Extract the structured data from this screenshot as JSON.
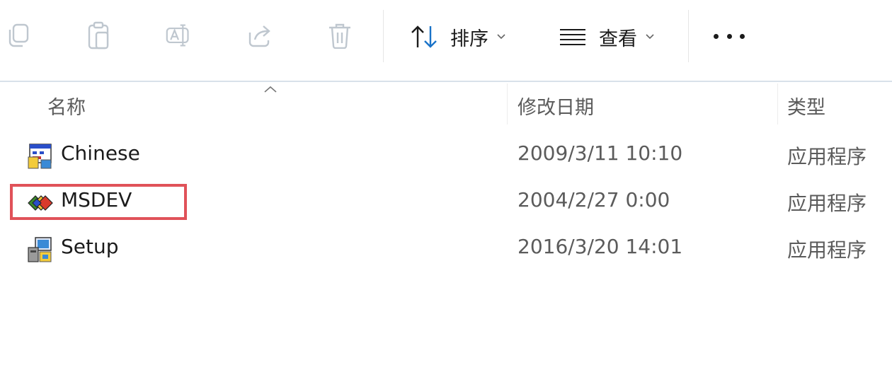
{
  "toolbar": {
    "icons": [
      {
        "name": "copy-icon"
      },
      {
        "name": "paste-icon"
      },
      {
        "name": "rename-icon"
      },
      {
        "name": "share-icon"
      },
      {
        "name": "delete-icon"
      }
    ],
    "sort_label": "排序",
    "view_label": "查看",
    "more_icon": "more-icon"
  },
  "columns": {
    "name": "名称",
    "date": "修改日期",
    "type": "类型"
  },
  "files": [
    {
      "name": "Chinese",
      "date": "2009/3/11 10:10",
      "type": "应用程序",
      "icon": "application-window-icon"
    },
    {
      "name": "MSDEV",
      "date": "2004/2/27 0:00",
      "type": "应用程序",
      "icon": "msdev-app-icon"
    },
    {
      "name": "Setup",
      "date": "2016/3/20 14:01",
      "type": "应用程序",
      "icon": "setup-installer-icon"
    }
  ],
  "highlight": {
    "target": "MSDEV",
    "color": "#e05259"
  }
}
